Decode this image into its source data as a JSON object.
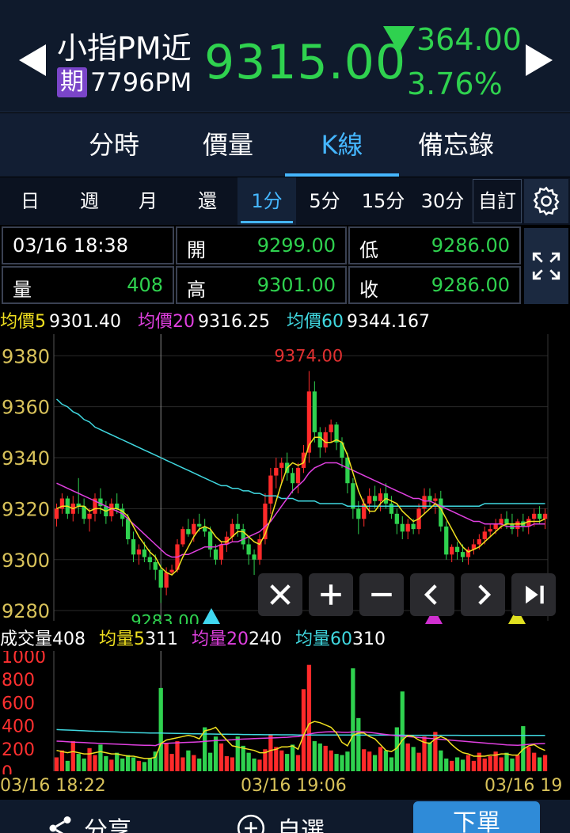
{
  "header": {
    "name": "小指PM近",
    "contract_badge": "期",
    "contract_code": "7796PM",
    "price": "9315.00",
    "change": "364.00",
    "change_pct": "3.76%",
    "colors": {
      "up": "#ff2a2a",
      "down": "#2fd24f",
      "accent": "#45b6ff"
    }
  },
  "main_tabs": [
    {
      "label": "分時",
      "active": false
    },
    {
      "label": "價量",
      "active": false
    },
    {
      "label": "K線",
      "active": true
    },
    {
      "label": "備忘錄",
      "active": false
    }
  ],
  "periods": [
    {
      "label": "日"
    },
    {
      "label": "週"
    },
    {
      "label": "月"
    },
    {
      "label": "還"
    },
    {
      "label": "1分",
      "active": true
    },
    {
      "label": "5分"
    },
    {
      "label": "15分"
    },
    {
      "label": "30分"
    },
    {
      "label": "自訂"
    }
  ],
  "icons": {
    "prev": "triangle-left-icon",
    "next": "triangle-right-icon",
    "settings": "gear-icon",
    "expand": "expand-icon"
  },
  "info": {
    "datetime": "03/16 18:38",
    "open_label": "開",
    "open": "9299.00",
    "low_label": "低",
    "low": "9286.00",
    "volume_label": "量",
    "volume": "408",
    "high_label": "高",
    "high": "9301.00",
    "close_label": "收",
    "close": "9286.00"
  },
  "ma": {
    "ma5_label": "均價5",
    "ma5": "9301.40",
    "ma20_label": "均價20",
    "ma20": "9316.25",
    "ma60_label": "均價60",
    "ma60": "9344.167",
    "colors": {
      "ma5": "#f0e020",
      "ma20": "#e040e0",
      "ma60": "#40d8e0"
    }
  },
  "vol_ma": {
    "vol_label": "成交量",
    "vol": "408",
    "ma5_label": "均量5",
    "ma5": "311",
    "ma20_label": "均量20",
    "ma20": "240",
    "ma60_label": "均量60",
    "ma60": "310"
  },
  "chart_data": [
    {
      "type": "candlestick",
      "ylim": [
        9276,
        9386
      ],
      "y_ticks": [
        9380,
        9360,
        9340,
        9320,
        9300,
        9280
      ],
      "annotations": {
        "max_label": "9374.00",
        "max_value": 9374,
        "min_label": "9283.00",
        "min_value": 9283
      },
      "n_candles": 90,
      "candles": [
        [
          9316,
          9322,
          9313,
          9320
        ],
        [
          9320,
          9326,
          9318,
          9324
        ],
        [
          9324,
          9325,
          9316,
          9318
        ],
        [
          9318,
          9325,
          9315,
          9322
        ],
        [
          9322,
          9332,
          9318,
          9321
        ],
        [
          9321,
          9324,
          9314,
          9316
        ],
        [
          9316,
          9320,
          9311,
          9318
        ],
        [
          9318,
          9326,
          9315,
          9324
        ],
        [
          9324,
          9328,
          9318,
          9321
        ],
        [
          9321,
          9323,
          9314,
          9317
        ],
        [
          9317,
          9324,
          9315,
          9322
        ],
        [
          9322,
          9326,
          9318,
          9320
        ],
        [
          9320,
          9322,
          9313,
          9316
        ],
        [
          9316,
          9318,
          9306,
          9308
        ],
        [
          9308,
          9311,
          9299,
          9302
        ],
        [
          9302,
          9306,
          9298,
          9304
        ],
        [
          9304,
          9307,
          9299,
          9301
        ],
        [
          9301,
          9304,
          9296,
          9299
        ],
        [
          9299,
          9302,
          9292,
          9296
        ],
        [
          9296,
          9298,
          9283,
          9289
        ],
        [
          9289,
          9297,
          9286,
          9295
        ],
        [
          9295,
          9298,
          9294,
          9296
        ],
        [
          9296,
          9308,
          9295,
          9306
        ],
        [
          9306,
          9313,
          9305,
          9312
        ],
        [
          9312,
          9316,
          9309,
          9310
        ],
        [
          9310,
          9316,
          9307,
          9314
        ],
        [
          9314,
          9318,
          9311,
          9313
        ],
        [
          9313,
          9316,
          9309,
          9311
        ],
        [
          9311,
          9313,
          9301,
          9304
        ],
        [
          9304,
          9306,
          9298,
          9300
        ],
        [
          9300,
          9307,
          9298,
          9306
        ],
        [
          9306,
          9311,
          9303,
          9309
        ],
        [
          9309,
          9316,
          9307,
          9314
        ],
        [
          9314,
          9318,
          9309,
          9312
        ],
        [
          9312,
          9314,
          9304,
          9306
        ],
        [
          9306,
          9309,
          9298,
          9302
        ],
        [
          9302,
          9304,
          9294,
          9300
        ],
        [
          9300,
          9310,
          9298,
          9308
        ],
        [
          9308,
          9326,
          9306,
          9322
        ],
        [
          9322,
          9336,
          9318,
          9333
        ],
        [
          9333,
          9340,
          9328,
          9336
        ],
        [
          9336,
          9340,
          9330,
          9338
        ],
        [
          9338,
          9342,
          9331,
          9334
        ],
        [
          9334,
          9336,
          9326,
          9330
        ],
        [
          9330,
          9338,
          9326,
          9336
        ],
        [
          9336,
          9345,
          9334,
          9342
        ],
        [
          9342,
          9374,
          9338,
          9366
        ],
        [
          9366,
          9370,
          9346,
          9350
        ],
        [
          9350,
          9352,
          9340,
          9344
        ],
        [
          9344,
          9352,
          9342,
          9350
        ],
        [
          9350,
          9355,
          9346,
          9353
        ],
        [
          9353,
          9354,
          9343,
          9346
        ],
        [
          9346,
          9348,
          9336,
          9340
        ],
        [
          9340,
          9342,
          9326,
          9330
        ],
        [
          9330,
          9332,
          9316,
          9320
        ],
        [
          9320,
          9323,
          9310,
          9316
        ],
        [
          9316,
          9324,
          9313,
          9322
        ],
        [
          9322,
          9328,
          9318,
          9325
        ],
        [
          9325,
          9329,
          9320,
          9323
        ],
        [
          9323,
          9328,
          9319,
          9326
        ],
        [
          9326,
          9330,
          9320,
          9322
        ],
        [
          9322,
          9325,
          9316,
          9318
        ],
        [
          9318,
          9320,
          9310,
          9314
        ],
        [
          9314,
          9317,
          9308,
          9311
        ],
        [
          9311,
          9316,
          9308,
          9314
        ],
        [
          9314,
          9316,
          9310,
          9312
        ],
        [
          9312,
          9322,
          9310,
          9320
        ],
        [
          9320,
          9328,
          9318,
          9325
        ],
        [
          9325,
          9328,
          9321,
          9323
        ],
        [
          9323,
          9326,
          9318,
          9324
        ],
        [
          9324,
          9327,
          9311,
          9313
        ],
        [
          9313,
          9315,
          9300,
          9302
        ],
        [
          9302,
          9306,
          9299,
          9305
        ],
        [
          9305,
          9307,
          9300,
          9303
        ],
        [
          9303,
          9306,
          9299,
          9301
        ],
        [
          9301,
          9305,
          9298,
          9304
        ],
        [
          9304,
          9308,
          9302,
          9306
        ],
        [
          9306,
          9310,
          9304,
          9308
        ],
        [
          9308,
          9313,
          9306,
          9311
        ],
        [
          9311,
          9314,
          9309,
          9312
        ],
        [
          9312,
          9316,
          9310,
          9314
        ],
        [
          9314,
          9318,
          9312,
          9316
        ],
        [
          9316,
          9319,
          9312,
          9314
        ],
        [
          9314,
          9318,
          9310,
          9312
        ],
        [
          9312,
          9316,
          9309,
          9315
        ],
        [
          9315,
          9318,
          9311,
          9313
        ],
        [
          9313,
          9317,
          9310,
          9316
        ],
        [
          9316,
          9320,
          9313,
          9318
        ],
        [
          9318,
          9321,
          9314,
          9316
        ],
        [
          9316,
          9320,
          9312,
          9318
        ]
      ],
      "ma5": [
        9320,
        9321,
        9321,
        9320,
        9321,
        9321,
        9319,
        9320,
        9320,
        9319,
        9320,
        9320,
        9319,
        9317,
        9313,
        9309,
        9306,
        9303,
        9301,
        9297,
        9295,
        9294,
        9296,
        9301,
        9305,
        9309,
        9312,
        9313,
        9312,
        9309,
        9307,
        9307,
        9309,
        9311,
        9311,
        9309,
        9307,
        9306,
        9310,
        9316,
        9323,
        9330,
        9336,
        9338,
        9337,
        9338,
        9345,
        9348,
        9348,
        9346,
        9346,
        9347,
        9346,
        9341,
        9334,
        9327,
        9322,
        9319,
        9319,
        9322,
        9324,
        9323,
        9322,
        9319,
        9317,
        9315,
        9316,
        9318,
        9320,
        9322,
        9320,
        9316,
        9312,
        9308,
        9305,
        9303,
        9304,
        9305,
        9307,
        9309,
        9311,
        9313,
        9314,
        9314,
        9314,
        9314,
        9315,
        9315,
        9315,
        9316
      ],
      "ma20": [
        9330,
        9329,
        9328,
        9327,
        9326,
        9325,
        9324,
        9323,
        9322,
        9321,
        9320,
        9319,
        9318,
        9316,
        9314,
        9312,
        9310,
        9308,
        9306,
        9304,
        9302,
        9301,
        9301,
        9302,
        9302,
        9303,
        9304,
        9305,
        9305,
        9305,
        9306,
        9306,
        9307,
        9307,
        9308,
        9309,
        9310,
        9311,
        9313,
        9315,
        9318,
        9321,
        9324,
        9327,
        9329,
        9331,
        9334,
        9336,
        9337,
        9338,
        9338,
        9338,
        9337,
        9336,
        9335,
        9334,
        9333,
        9332,
        9331,
        9330,
        9329,
        9328,
        9327,
        9326,
        9325,
        9324,
        9324,
        9323,
        9323,
        9322,
        9321,
        9320,
        9319,
        9318,
        9317,
        9316,
        9315,
        9315,
        9314,
        9314,
        9314,
        9314,
        9313,
        9313,
        9313,
        9313,
        9313,
        9314,
        9314,
        9314
      ],
      "ma60": [
        9363,
        9361,
        9360,
        9358,
        9357,
        9355,
        9354,
        9352,
        9351,
        9350,
        9349,
        9348,
        9347,
        9346,
        9345,
        9344,
        9343,
        9342,
        9341,
        9340,
        9339,
        9338,
        9337,
        9336,
        9335,
        9334,
        9333,
        9332,
        9331,
        9330,
        9329,
        9329,
        9328,
        9328,
        9327,
        9327,
        9326,
        9326,
        9325,
        9325,
        9325,
        9324,
        9324,
        9324,
        9323,
        9323,
        9323,
        9323,
        9322,
        9322,
        9322,
        9322,
        9322,
        9321,
        9321,
        9321,
        9321,
        9321,
        9321,
        9321,
        9321,
        9321,
        9321,
        9321,
        9321,
        9321,
        9321,
        9321,
        9321,
        9321,
        9321,
        9321,
        9321,
        9321,
        9321,
        9321,
        9321,
        9321,
        9322,
        9322,
        9322,
        9322,
        9322,
        9322,
        9322,
        9322,
        9322,
        9322,
        9322,
        9322
      ]
    },
    {
      "type": "bar",
      "ylim": [
        0,
        1000
      ],
      "y_ticks": [
        1000,
        800,
        600,
        400,
        200,
        0
      ],
      "volumes": [
        120,
        180,
        90,
        260,
        150,
        110,
        200,
        140,
        230,
        130,
        100,
        160,
        110,
        140,
        120,
        90,
        80,
        110,
        170,
        720,
        240,
        150,
        260,
        120,
        180,
        140,
        110,
        380,
        160,
        300,
        240,
        130,
        120,
        300,
        220,
        160,
        110,
        100,
        190,
        320,
        210,
        180,
        150,
        230,
        140,
        710,
        920,
        260,
        240,
        220,
        180,
        150,
        140,
        170,
        890,
        460,
        190,
        170,
        140,
        210,
        180,
        120,
        380,
        690,
        240,
        210,
        160,
        300,
        250,
        340,
        180,
        110,
        90,
        120,
        100,
        140,
        90,
        160,
        110,
        130,
        170,
        120,
        160,
        110,
        140,
        390,
        210,
        160,
        120,
        140
      ],
      "x_ticks": [
        "03/16 18:22",
        "03/16 19:06",
        "03/16 19"
      ],
      "ma5": [
        180,
        170,
        160,
        170,
        160,
        150,
        150,
        160,
        170,
        160,
        150,
        150,
        140,
        130,
        130,
        120,
        110,
        110,
        120,
        240,
        270,
        280,
        290,
        300,
        310,
        300,
        280,
        350,
        360,
        380,
        320,
        270,
        220,
        210,
        200,
        190,
        180,
        160,
        160,
        180,
        190,
        210,
        210,
        220,
        190,
        310,
        410,
        430,
        420,
        400,
        380,
        330,
        250,
        220,
        310,
        330,
        330,
        300,
        280,
        230,
        180,
        170,
        200,
        270,
        310,
        300,
        270,
        250,
        240,
        280,
        300,
        280,
        230,
        190,
        160,
        150,
        130,
        130,
        130,
        140,
        140,
        150,
        150,
        140,
        140,
        190,
        220,
        230,
        200,
        180
      ],
      "ma20": [
        260,
        258,
        255,
        252,
        250,
        248,
        245,
        243,
        240,
        238,
        236,
        234,
        232,
        230,
        228,
        226,
        225,
        224,
        222,
        240,
        242,
        244,
        246,
        248,
        250,
        252,
        254,
        258,
        262,
        266,
        268,
        270,
        272,
        275,
        278,
        280,
        282,
        284,
        286,
        288,
        290,
        292,
        294,
        298,
        300,
        310,
        322,
        330,
        336,
        340,
        342,
        340,
        338,
        336,
        340,
        342,
        340,
        336,
        330,
        324,
        318,
        312,
        306,
        304,
        300,
        296,
        292,
        288,
        284,
        280,
        276,
        272,
        268,
        264,
        260,
        256,
        252,
        248,
        244,
        240,
        236,
        232,
        228,
        226,
        224,
        228,
        232,
        236,
        238,
        240
      ],
      "ma60": [
        360,
        358,
        356,
        354,
        352,
        350,
        348,
        346,
        345,
        344,
        342,
        340,
        338,
        336,
        334,
        333,
        332,
        331,
        330,
        330,
        329,
        328,
        327,
        326,
        325,
        324,
        323,
        322,
        322,
        321,
        320,
        320,
        319,
        319,
        318,
        318,
        317,
        317,
        316,
        316,
        316,
        315,
        315,
        315,
        314,
        314,
        314,
        314,
        314,
        313,
        313,
        313,
        313,
        313,
        313,
        312,
        312,
        312,
        312,
        312,
        312,
        312,
        312,
        312,
        311,
        311,
        311,
        311,
        311,
        311,
        311,
        311,
        311,
        311,
        310,
        310,
        310,
        310,
        310,
        310,
        310,
        310,
        310,
        310,
        310,
        310,
        310,
        310,
        310,
        310
      ]
    }
  ],
  "controls": [
    {
      "name": "close-chart-button",
      "icon": "close-icon"
    },
    {
      "name": "zoom-in-button",
      "icon": "plus-icon"
    },
    {
      "name": "zoom-out-button",
      "icon": "minus-icon"
    },
    {
      "name": "scroll-left-button",
      "icon": "chevron-left-icon"
    },
    {
      "name": "scroll-right-button",
      "icon": "chevron-right-icon"
    },
    {
      "name": "scroll-end-button",
      "icon": "skip-end-icon"
    }
  ],
  "bottom": {
    "share_label": "分享",
    "watch_label": "自選",
    "order_label": "下單"
  }
}
